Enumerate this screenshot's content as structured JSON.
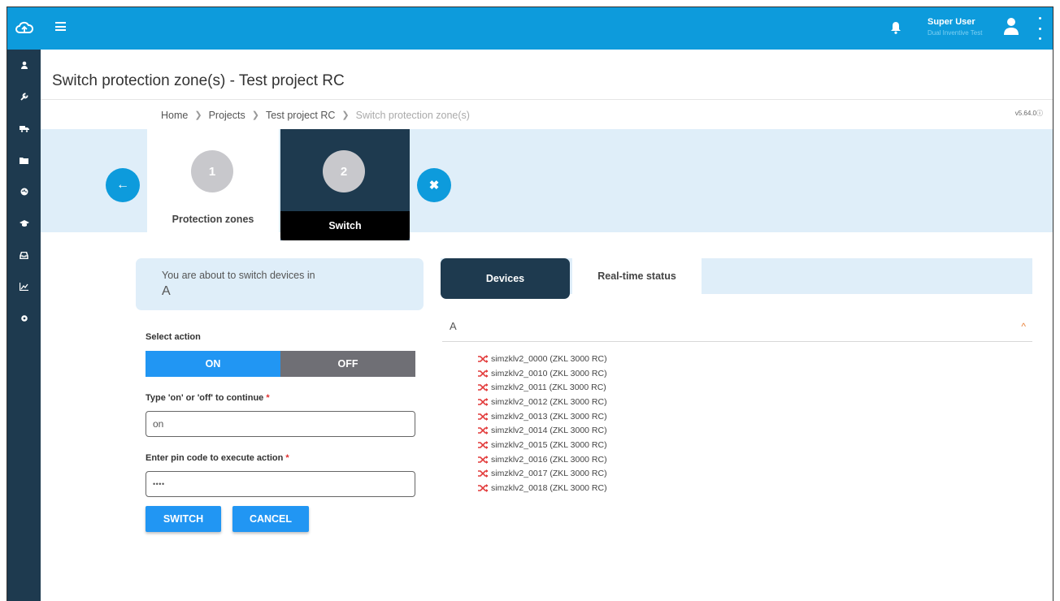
{
  "colors": {
    "sidebar": "#1e3a4f",
    "topbar": "#0d9bdc",
    "accent": "#2196f3",
    "step_active": "#1e3a4f",
    "band": "#dfeef9",
    "device_icon": "#e23b3b"
  },
  "sidebar": {
    "logo_icon": "cloud-icon",
    "items": [
      {
        "icon": "user-icon"
      },
      {
        "icon": "wrench-icon"
      },
      {
        "icon": "truck-icon"
      },
      {
        "icon": "folder-icon"
      },
      {
        "icon": "globe-icon"
      },
      {
        "icon": "graduation-cap-icon"
      },
      {
        "icon": "inbox-icon"
      },
      {
        "icon": "chart-icon"
      },
      {
        "icon": "gear-icon"
      }
    ]
  },
  "topbar": {
    "user_name": "Super User",
    "user_org": "Dual Inventive Test"
  },
  "page": {
    "title": "Switch protection zone(s) - Test project RC",
    "version": "v5.64.0"
  },
  "breadcrumb": [
    "Home",
    "Projects",
    "Test project RC",
    "Switch protection zone(s)"
  ],
  "stepper": {
    "steps": [
      {
        "number": "1",
        "label": "Protection zones"
      },
      {
        "number": "2",
        "label": "Switch"
      }
    ]
  },
  "info": {
    "line1": "You are about to switch devices in",
    "zone": "A"
  },
  "form": {
    "select_action_label": "Select action",
    "on_label": "ON",
    "off_label": "OFF",
    "selected_action": "ON",
    "confirm_label": "Type 'on' or 'off' to continue",
    "confirm_value": "on",
    "pin_label": "Enter pin code to execute action",
    "pin_value": "••••",
    "required_mark": "*",
    "switch_button": "SWITCH",
    "cancel_button": "CANCEL"
  },
  "tabs": [
    "Devices",
    "Real-time status"
  ],
  "devices_panel": {
    "group": "A",
    "items": [
      "simzklv2_0000 (ZKL 3000 RC)",
      "simzklv2_0010 (ZKL 3000 RC)",
      "simzklv2_0011 (ZKL 3000 RC)",
      "simzklv2_0012 (ZKL 3000 RC)",
      "simzklv2_0013 (ZKL 3000 RC)",
      "simzklv2_0014 (ZKL 3000 RC)",
      "simzklv2_0015 (ZKL 3000 RC)",
      "simzklv2_0016 (ZKL 3000 RC)",
      "simzklv2_0017 (ZKL 3000 RC)",
      "simzklv2_0018 (ZKL 3000 RC)"
    ]
  }
}
